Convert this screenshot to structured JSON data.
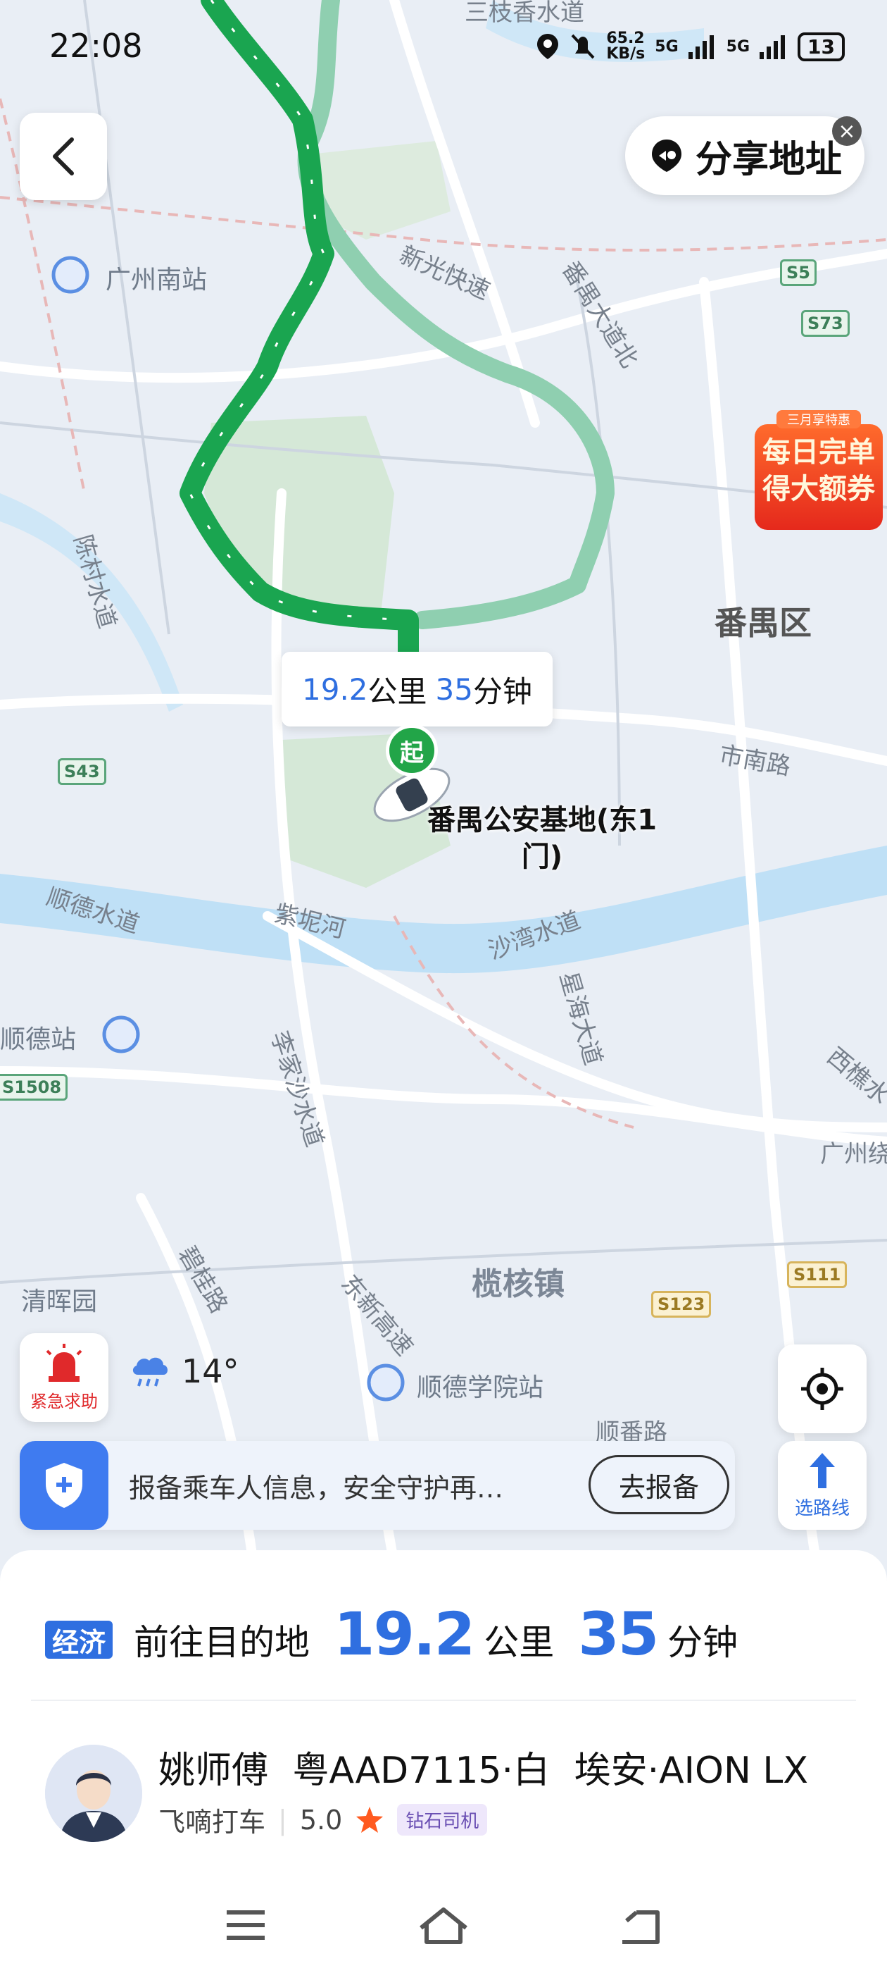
{
  "status_bar": {
    "time": "22:08",
    "net_speed": "65.2",
    "net_unit": "KB/s",
    "signal1": "5G",
    "signal2": "5G",
    "battery": "13"
  },
  "map": {
    "labels": {
      "guangzhou_south": "广州南站",
      "xinguang_expwy": "新光快速",
      "panyu_ave_n": "番禺大道北",
      "panyu_district": "番禺区",
      "chencun_water": "陈村水道",
      "shinan_rd": "市南路",
      "shunde_water": "顺德水道",
      "zini_river": "紫坭河",
      "shawan_water": "沙湾水道",
      "xinghai_ave": "星海大道",
      "shunde_station": "顺德站",
      "lijiasha_water": "李家沙水道",
      "xijiao": "西樵水",
      "guangzhou_ring": "广州绕",
      "bigui_rd": "碧桂路",
      "dongxin_hwy": "东新高速",
      "lanhe_town": "榄核镇",
      "qinghui_garden": "清晖园",
      "shunde_college_station": "顺德学院站",
      "shunfan_rd": "顺番路",
      "top_water": "三枝香水道"
    },
    "shields": [
      "S5",
      "S73",
      "S43",
      "S111",
      "S123",
      "S1508"
    ],
    "route_info": {
      "distance": "19.2",
      "distance_unit": "公里",
      "time": "35",
      "time_unit": "分钟"
    },
    "start_marker": "起",
    "place_label": "番禺公安基地(东1门)"
  },
  "share": {
    "label": "分享地址",
    "close": "×"
  },
  "promo": {
    "tag": "三月享特惠",
    "line1": "每日完单",
    "line2": "得大额券"
  },
  "sos": {
    "label": "紧急求助"
  },
  "weather": {
    "temp": "14°"
  },
  "route_select": {
    "label": "选路线"
  },
  "safety": {
    "text": "报备乘车人信息，安全守护再…",
    "button": "去报备"
  },
  "trip": {
    "tag": "经济",
    "heading": "前往目的地",
    "distance": "19.2",
    "distance_unit": "公里",
    "time": "35",
    "time_unit": "分钟"
  },
  "driver": {
    "name": "姚师傅",
    "plate": "粤AAD7115·白",
    "car": "埃安·AION LX",
    "platform": "飞嘀打车",
    "rating": "5.0",
    "badge": "钻石司机"
  },
  "colors": {
    "accent": "#2f6fe0",
    "route": "#1aa550",
    "route_alt": "#8fcfb0",
    "sos": "#e0292b"
  }
}
